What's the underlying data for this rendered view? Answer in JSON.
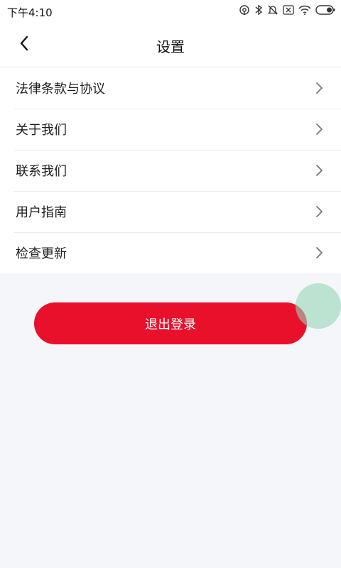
{
  "status_bar": {
    "time": "下午4:10",
    "icons": [
      "hotspot-icon",
      "bluetooth-icon",
      "mute-icon",
      "sim-off-icon",
      "wifi-icon",
      "battery-icon"
    ]
  },
  "nav": {
    "title": "设置",
    "back_icon": "chevron-left-icon"
  },
  "menu": {
    "items": [
      {
        "label": "法律条款与协议"
      },
      {
        "label": "关于我们"
      },
      {
        "label": "联系我们"
      },
      {
        "label": "用户指南"
      },
      {
        "label": "检查更新"
      }
    ]
  },
  "actions": {
    "logout_label": "退出登录"
  },
  "colors": {
    "accent": "#e8102a",
    "background": "#f5f6fa",
    "assist_bubble": "#96d6b6"
  }
}
